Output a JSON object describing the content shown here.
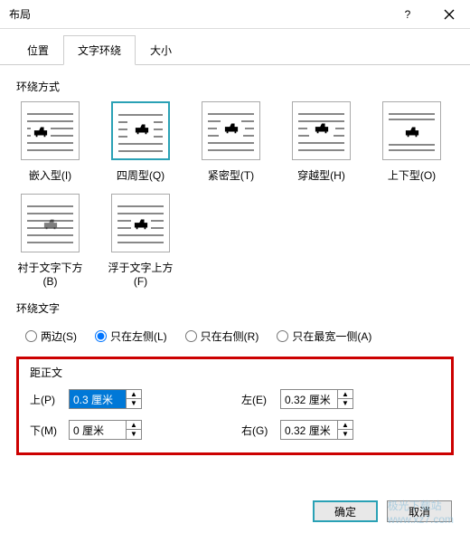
{
  "title": "布局",
  "tabs": {
    "position": "位置",
    "wrap": "文字环绕",
    "size": "大小"
  },
  "group_wrap": "环绕方式",
  "wrap_items": {
    "inline": "嵌入型(I)",
    "square": "四周型(Q)",
    "tight": "紧密型(T)",
    "through": "穿越型(H)",
    "topbottom": "上下型(O)",
    "behind": "衬于文字下方(B)",
    "front": "浮于文字上方(F)"
  },
  "group_text": "环绕文字",
  "radios": {
    "both": "两边(S)",
    "left": "只在左侧(L)",
    "right": "只在右侧(R)",
    "widest": "只在最宽一侧(A)"
  },
  "group_dist": "距正文",
  "dist": {
    "top_label": "上(P)",
    "top_value": "0.3 厘米",
    "bottom_label": "下(M)",
    "bottom_value": "0 厘米",
    "left_label": "左(E)",
    "left_value": "0.32 厘米",
    "right_label": "右(G)",
    "right_value": "0.32 厘米"
  },
  "buttons": {
    "ok": "确定",
    "cancel": "取消"
  },
  "watermark": {
    "line1": "极光下载站",
    "line2": "www.xz7.com"
  }
}
